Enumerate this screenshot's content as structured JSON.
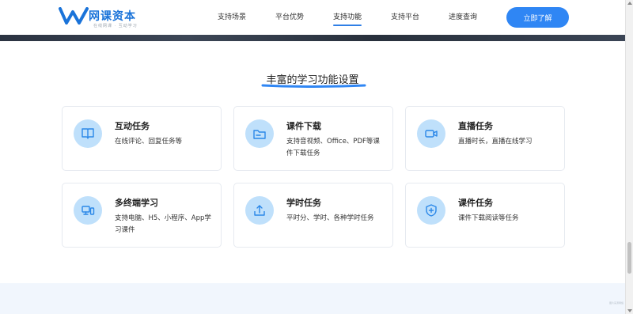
{
  "header": {
    "logo": {
      "name": "网课资本",
      "slogan": "在线网课 · 互动学习"
    },
    "nav": [
      {
        "label": "支持场景",
        "active": false
      },
      {
        "label": "平台优势",
        "active": false
      },
      {
        "label": "支持功能",
        "active": true
      },
      {
        "label": "支持平台",
        "active": false
      },
      {
        "label": "进度查询",
        "active": false
      }
    ],
    "cta_label": "立即了解"
  },
  "section": {
    "title": "丰富的学习功能设置",
    "cards": [
      {
        "title": "互动任务",
        "description": "在线评论、回复任务等",
        "icon": "book-icon"
      },
      {
        "title": "课件下载",
        "description": "支持音视频、Office、PDF等课件下载任务",
        "icon": "folder-icon"
      },
      {
        "title": "直播任务",
        "description": "直播时长，直播在线学习",
        "icon": "video-camera-icon"
      },
      {
        "title": "多终端学习",
        "description": "支持电脑、H5、小程序、App学习课件",
        "icon": "devices-icon"
      },
      {
        "title": "学时任务",
        "description": "平时分、学时、各种学时任务",
        "icon": "upload-tray-icon"
      },
      {
        "title": "课件任务",
        "description": "课件下载阅读等任务",
        "icon": "shield-plus-icon"
      }
    ]
  },
  "footer": {
    "watermark": "图片来源网络"
  },
  "colors": {
    "accent": "#2f86f4",
    "icon_bg": "#bfe0fb",
    "icon_stroke": "#2a87e8",
    "dark_band": "#2b3341",
    "bottom_band": "#f1f6fd"
  }
}
